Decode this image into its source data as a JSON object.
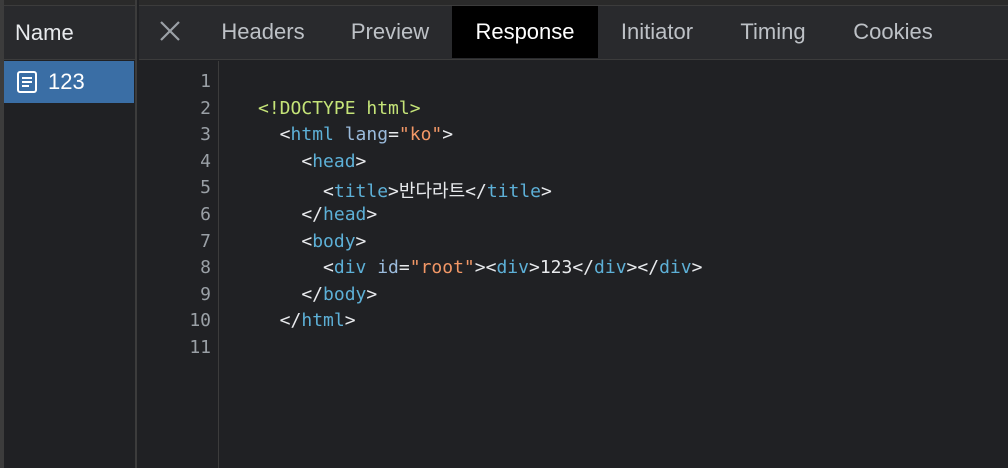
{
  "left_panel": {
    "header": "Name",
    "request": {
      "label": "123",
      "icon": "document-icon"
    }
  },
  "tabs": [
    {
      "label": "Headers",
      "active": false
    },
    {
      "label": "Preview",
      "active": false
    },
    {
      "label": "Response",
      "active": true
    },
    {
      "label": "Initiator",
      "active": false
    },
    {
      "label": "Timing",
      "active": false
    },
    {
      "label": "Cookies",
      "active": false
    }
  ],
  "close_icon": "close-icon",
  "code": {
    "line_numbers": [
      "1",
      "2",
      "3",
      "4",
      "5",
      "6",
      "7",
      "8",
      "9",
      "10",
      "11"
    ],
    "lines": [
      [],
      [
        {
          "t": "doc",
          "v": "<!DOCTYPE html>"
        }
      ],
      [
        {
          "t": "pun",
          "v": "  <"
        },
        {
          "t": "tag",
          "v": "html"
        },
        {
          "t": "pun",
          "v": " "
        },
        {
          "t": "attr",
          "v": "lang"
        },
        {
          "t": "pun",
          "v": "="
        },
        {
          "t": "val",
          "v": "\"ko\""
        },
        {
          "t": "pun",
          "v": ">"
        }
      ],
      [
        {
          "t": "pun",
          "v": "    <"
        },
        {
          "t": "tag",
          "v": "head"
        },
        {
          "t": "pun",
          "v": ">"
        }
      ],
      [
        {
          "t": "pun",
          "v": "      <"
        },
        {
          "t": "tag",
          "v": "title"
        },
        {
          "t": "pun",
          "v": ">"
        },
        {
          "t": "txt",
          "v": "반다라트"
        },
        {
          "t": "pun",
          "v": "</"
        },
        {
          "t": "tag",
          "v": "title"
        },
        {
          "t": "pun",
          "v": ">"
        }
      ],
      [
        {
          "t": "pun",
          "v": "    </"
        },
        {
          "t": "tag",
          "v": "head"
        },
        {
          "t": "pun",
          "v": ">"
        }
      ],
      [
        {
          "t": "pun",
          "v": "    <"
        },
        {
          "t": "tag",
          "v": "body"
        },
        {
          "t": "pun",
          "v": ">"
        }
      ],
      [
        {
          "t": "pun",
          "v": "      <"
        },
        {
          "t": "tag",
          "v": "div"
        },
        {
          "t": "pun",
          "v": " "
        },
        {
          "t": "attr",
          "v": "id"
        },
        {
          "t": "pun",
          "v": "="
        },
        {
          "t": "val",
          "v": "\"root\""
        },
        {
          "t": "pun",
          "v": "><"
        },
        {
          "t": "tag",
          "v": "div"
        },
        {
          "t": "pun",
          "v": ">"
        },
        {
          "t": "txt",
          "v": "123"
        },
        {
          "t": "pun",
          "v": "</"
        },
        {
          "t": "tag",
          "v": "div"
        },
        {
          "t": "pun",
          "v": "></"
        },
        {
          "t": "tag",
          "v": "div"
        },
        {
          "t": "pun",
          "v": ">"
        }
      ],
      [
        {
          "t": "pun",
          "v": "    </"
        },
        {
          "t": "tag",
          "v": "body"
        },
        {
          "t": "pun",
          "v": ">"
        }
      ],
      [
        {
          "t": "pun",
          "v": "  </"
        },
        {
          "t": "tag",
          "v": "html"
        },
        {
          "t": "pun",
          "v": ">"
        }
      ],
      []
    ]
  },
  "colors": {
    "tag": "#5db0d7",
    "attr": "#9bbbdc",
    "value": "#f29766",
    "doctype": "#c5e478",
    "selected_request": "#3a6ea5",
    "active_tab": "#000000"
  }
}
